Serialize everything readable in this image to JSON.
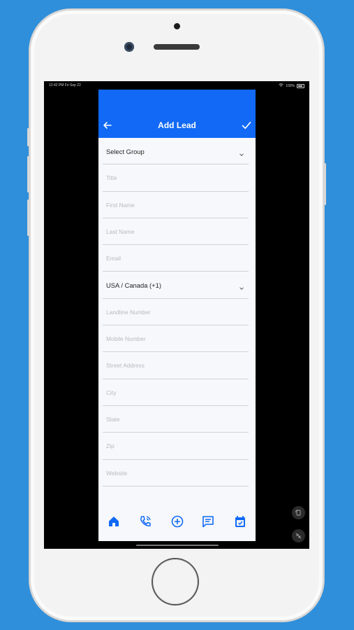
{
  "status_bar": {
    "time_date": "12:42 PM   Fri Sep 22",
    "battery": "100%"
  },
  "header": {
    "title": "Add Lead",
    "back_icon": "back-arrow-icon",
    "save_icon": "check-icon"
  },
  "form": {
    "group_select": "Select Group",
    "fields": {
      "title": "Title",
      "first_name": "First Name",
      "last_name": "Last Name",
      "email": "Email",
      "country_code": "USA / Canada (+1)",
      "landline": "Landline Number",
      "mobile": "Mobile Number",
      "street": "Street Address",
      "city": "City",
      "state": "State",
      "zip": "Zip",
      "website": "Website"
    }
  },
  "tabs": [
    "home-icon",
    "phone-call-icon",
    "add-circle-icon",
    "message-icon",
    "calendar-icon"
  ],
  "colors": {
    "background": "#2f8fdb",
    "accent": "#1169f5"
  }
}
